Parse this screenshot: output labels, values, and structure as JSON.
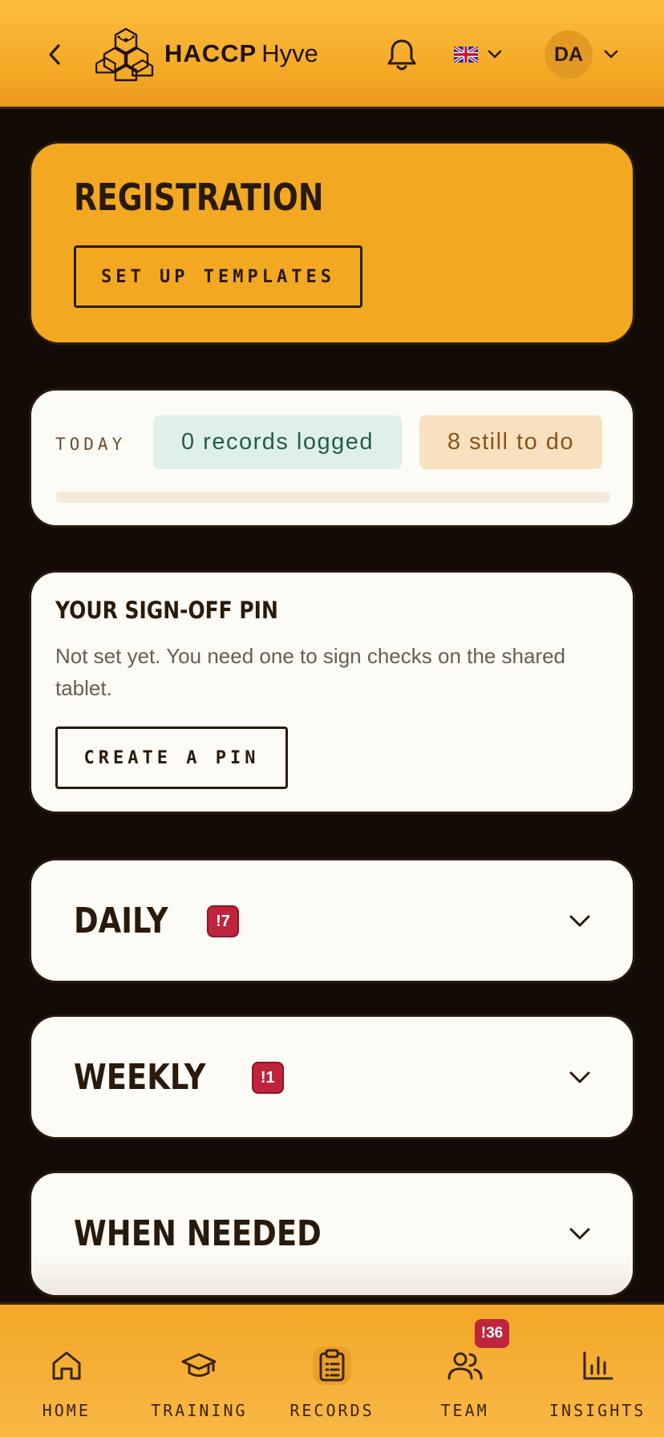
{
  "header": {
    "brand_main": "HACCP",
    "brand_sub": "Hyve",
    "avatar_initials": "DA",
    "icons": [
      "chevron-left-icon",
      "hive-logo",
      "bell-icon",
      "uk-flag-icon",
      "chevron-down-icon"
    ]
  },
  "registration": {
    "title": "REGISTRATION",
    "button_label": "SET UP TEMPLATES"
  },
  "today": {
    "label": "TODAY",
    "logged": "0 records logged",
    "todo": "8 still to do",
    "progress_fraction": 0
  },
  "pin": {
    "title": "YOUR SIGN-OFF PIN",
    "description": "Not set yet. You need one to sign checks on the shared tablet.",
    "button_label": "CREATE A PIN"
  },
  "sections": [
    {
      "title": "DAILY",
      "badge": "!7"
    },
    {
      "title": "WEEKLY",
      "badge": "!1"
    },
    {
      "title": "WHEN NEEDED",
      "badge": ""
    }
  ],
  "nav": {
    "items": [
      {
        "label": "HOME",
        "icon": "home-icon"
      },
      {
        "label": "TRAINING",
        "icon": "graduation-cap-icon"
      },
      {
        "label": "RECORDS",
        "icon": "clipboard-icon",
        "active": true
      },
      {
        "label": "TEAM",
        "icon": "users-icon",
        "badge": "!36"
      },
      {
        "label": "INSIGHTS",
        "icon": "bar-chart-icon"
      }
    ]
  },
  "colors": {
    "accent": "#f2a921",
    "dark": "#2a1a0b",
    "background": "#120b06",
    "card": "#fdfbf5",
    "badge": "#c0243c"
  }
}
